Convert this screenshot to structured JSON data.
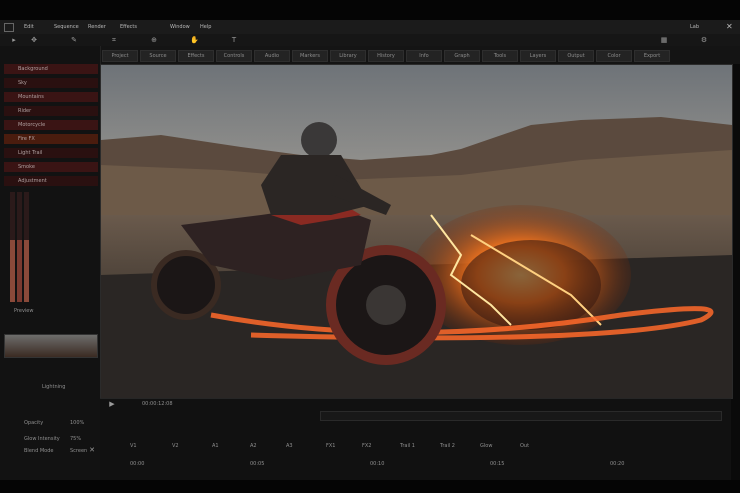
{
  "menu": {
    "items": [
      "Edit",
      "Sequence",
      "Render",
      "Effects",
      "Window",
      "Help"
    ],
    "right_label": "Lab"
  },
  "tabs": [
    "Project",
    "Source",
    "Effects",
    "Controls",
    "Audio",
    "Markers",
    "Library",
    "History",
    "Info",
    "Graph",
    "Tools",
    "Layers",
    "Output",
    "Color",
    "Export"
  ],
  "layers": [
    {
      "label": "Background",
      "color": "#6b1f1f"
    },
    {
      "label": "Sky",
      "color": "#5a1a1a"
    },
    {
      "label": "Mountains",
      "color": "#6a2222"
    },
    {
      "label": "Rider",
      "color": "#4a1818"
    },
    {
      "label": "Motorcycle",
      "color": "#5b1d1d"
    },
    {
      "label": "Fire FX",
      "color": "#7a2a10"
    },
    {
      "label": "Light Trail",
      "color": "#5a1a1a"
    },
    {
      "label": "Smoke",
      "color": "#4d1a1a"
    },
    {
      "label": "Adjustment",
      "color": "#5a1c1c"
    }
  ],
  "panel": {
    "preview_label": "Preview",
    "effect_label": "Lightning",
    "props": [
      "Opacity",
      "Glow Intensity",
      "Blend Mode"
    ],
    "values": [
      "100%",
      "75%",
      "Screen"
    ]
  },
  "timeline": {
    "header": "00:00:12:08",
    "track_labels": [
      "V1",
      "V2",
      "A1",
      "A2",
      "A3",
      "FX1",
      "FX2",
      "Trail 1",
      "Trail 2",
      "Glow",
      "Out"
    ],
    "timecodes": [
      "00:00",
      "00:05",
      "00:10",
      "00:15",
      "00:20"
    ]
  }
}
